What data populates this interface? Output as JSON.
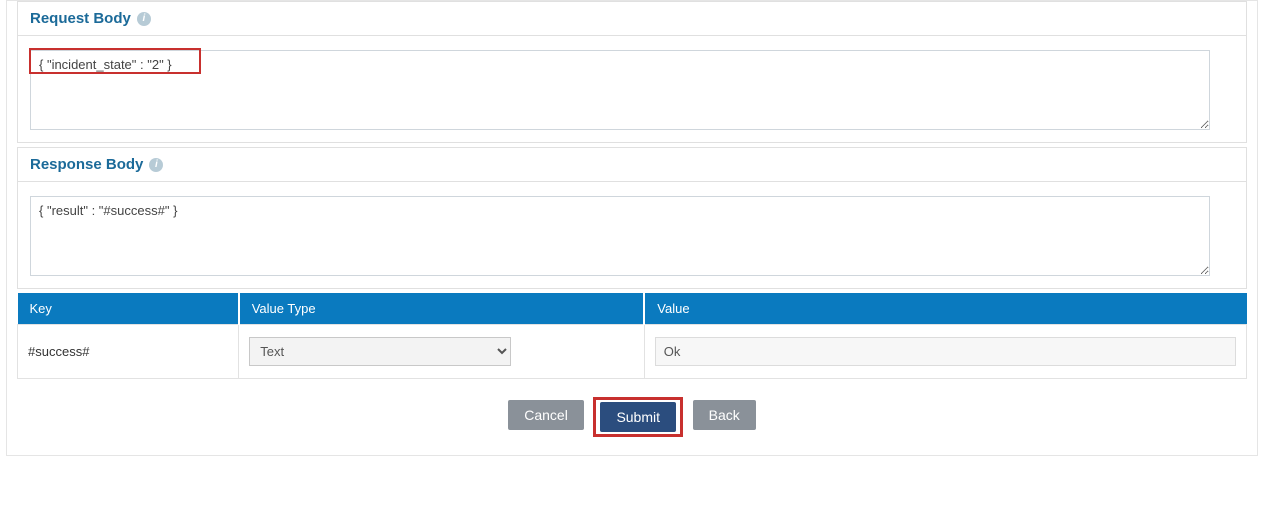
{
  "sections": {
    "request": {
      "title": "Request Body",
      "value": "{ \"incident_state\" : \"2\" }"
    },
    "response": {
      "title": "Response Body",
      "value": "{ \"result\" : \"#success#\" }"
    }
  },
  "table": {
    "headers": {
      "key": "Key",
      "type": "Value Type",
      "value": "Value"
    },
    "row": {
      "key": "#success#",
      "type_selected": "Text",
      "value": "Ok"
    }
  },
  "buttons": {
    "cancel": "Cancel",
    "submit": "Submit",
    "back": "Back"
  }
}
